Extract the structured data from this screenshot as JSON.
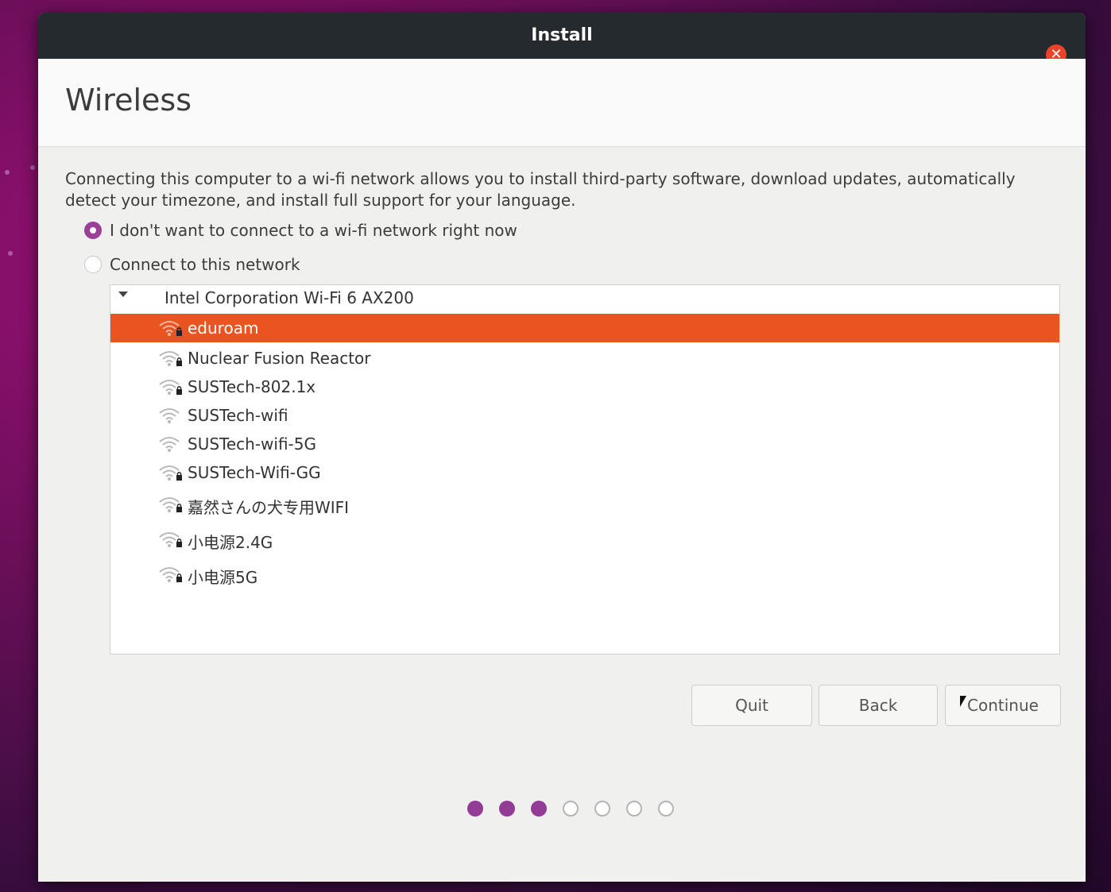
{
  "window": {
    "title": "Install"
  },
  "page": {
    "title": "Wireless",
    "description": "Connecting this computer to a wi-fi network allows you to install third-party software, download updates, automatically detect your timezone, and install full support for your language."
  },
  "options": {
    "no_connect_label": "I don't want to connect to a wi-fi network right now",
    "connect_label": "Connect to this network",
    "selected": "no_connect"
  },
  "network_list": {
    "adapter": "Intel Corporation Wi-Fi 6 AX200",
    "networks": [
      {
        "name": "eduroam",
        "secured": true,
        "selected": true
      },
      {
        "name": "Nuclear Fusion Reactor",
        "secured": true,
        "selected": false
      },
      {
        "name": "SUSTech-802.1x",
        "secured": true,
        "selected": false
      },
      {
        "name": "SUSTech-wifi",
        "secured": false,
        "selected": false
      },
      {
        "name": "SUSTech-wifi-5G",
        "secured": false,
        "selected": false
      },
      {
        "name": "SUSTech-Wifi-GG",
        "secured": true,
        "selected": false
      },
      {
        "name": "嘉然さんの犬专用WIFI",
        "secured": true,
        "selected": false
      },
      {
        "name": "小电源2.4G",
        "secured": true,
        "selected": false
      },
      {
        "name": "小电源5G",
        "secured": true,
        "selected": false
      }
    ]
  },
  "buttons": {
    "quit": "Quit",
    "back": "Back",
    "continue": "Continue"
  },
  "progress": {
    "completed_steps": 3,
    "total_steps": 7
  },
  "colors": {
    "accent": "#e95420",
    "progress_done": "#923c95",
    "titlebar": "#252a2f",
    "close": "#e9432a"
  }
}
